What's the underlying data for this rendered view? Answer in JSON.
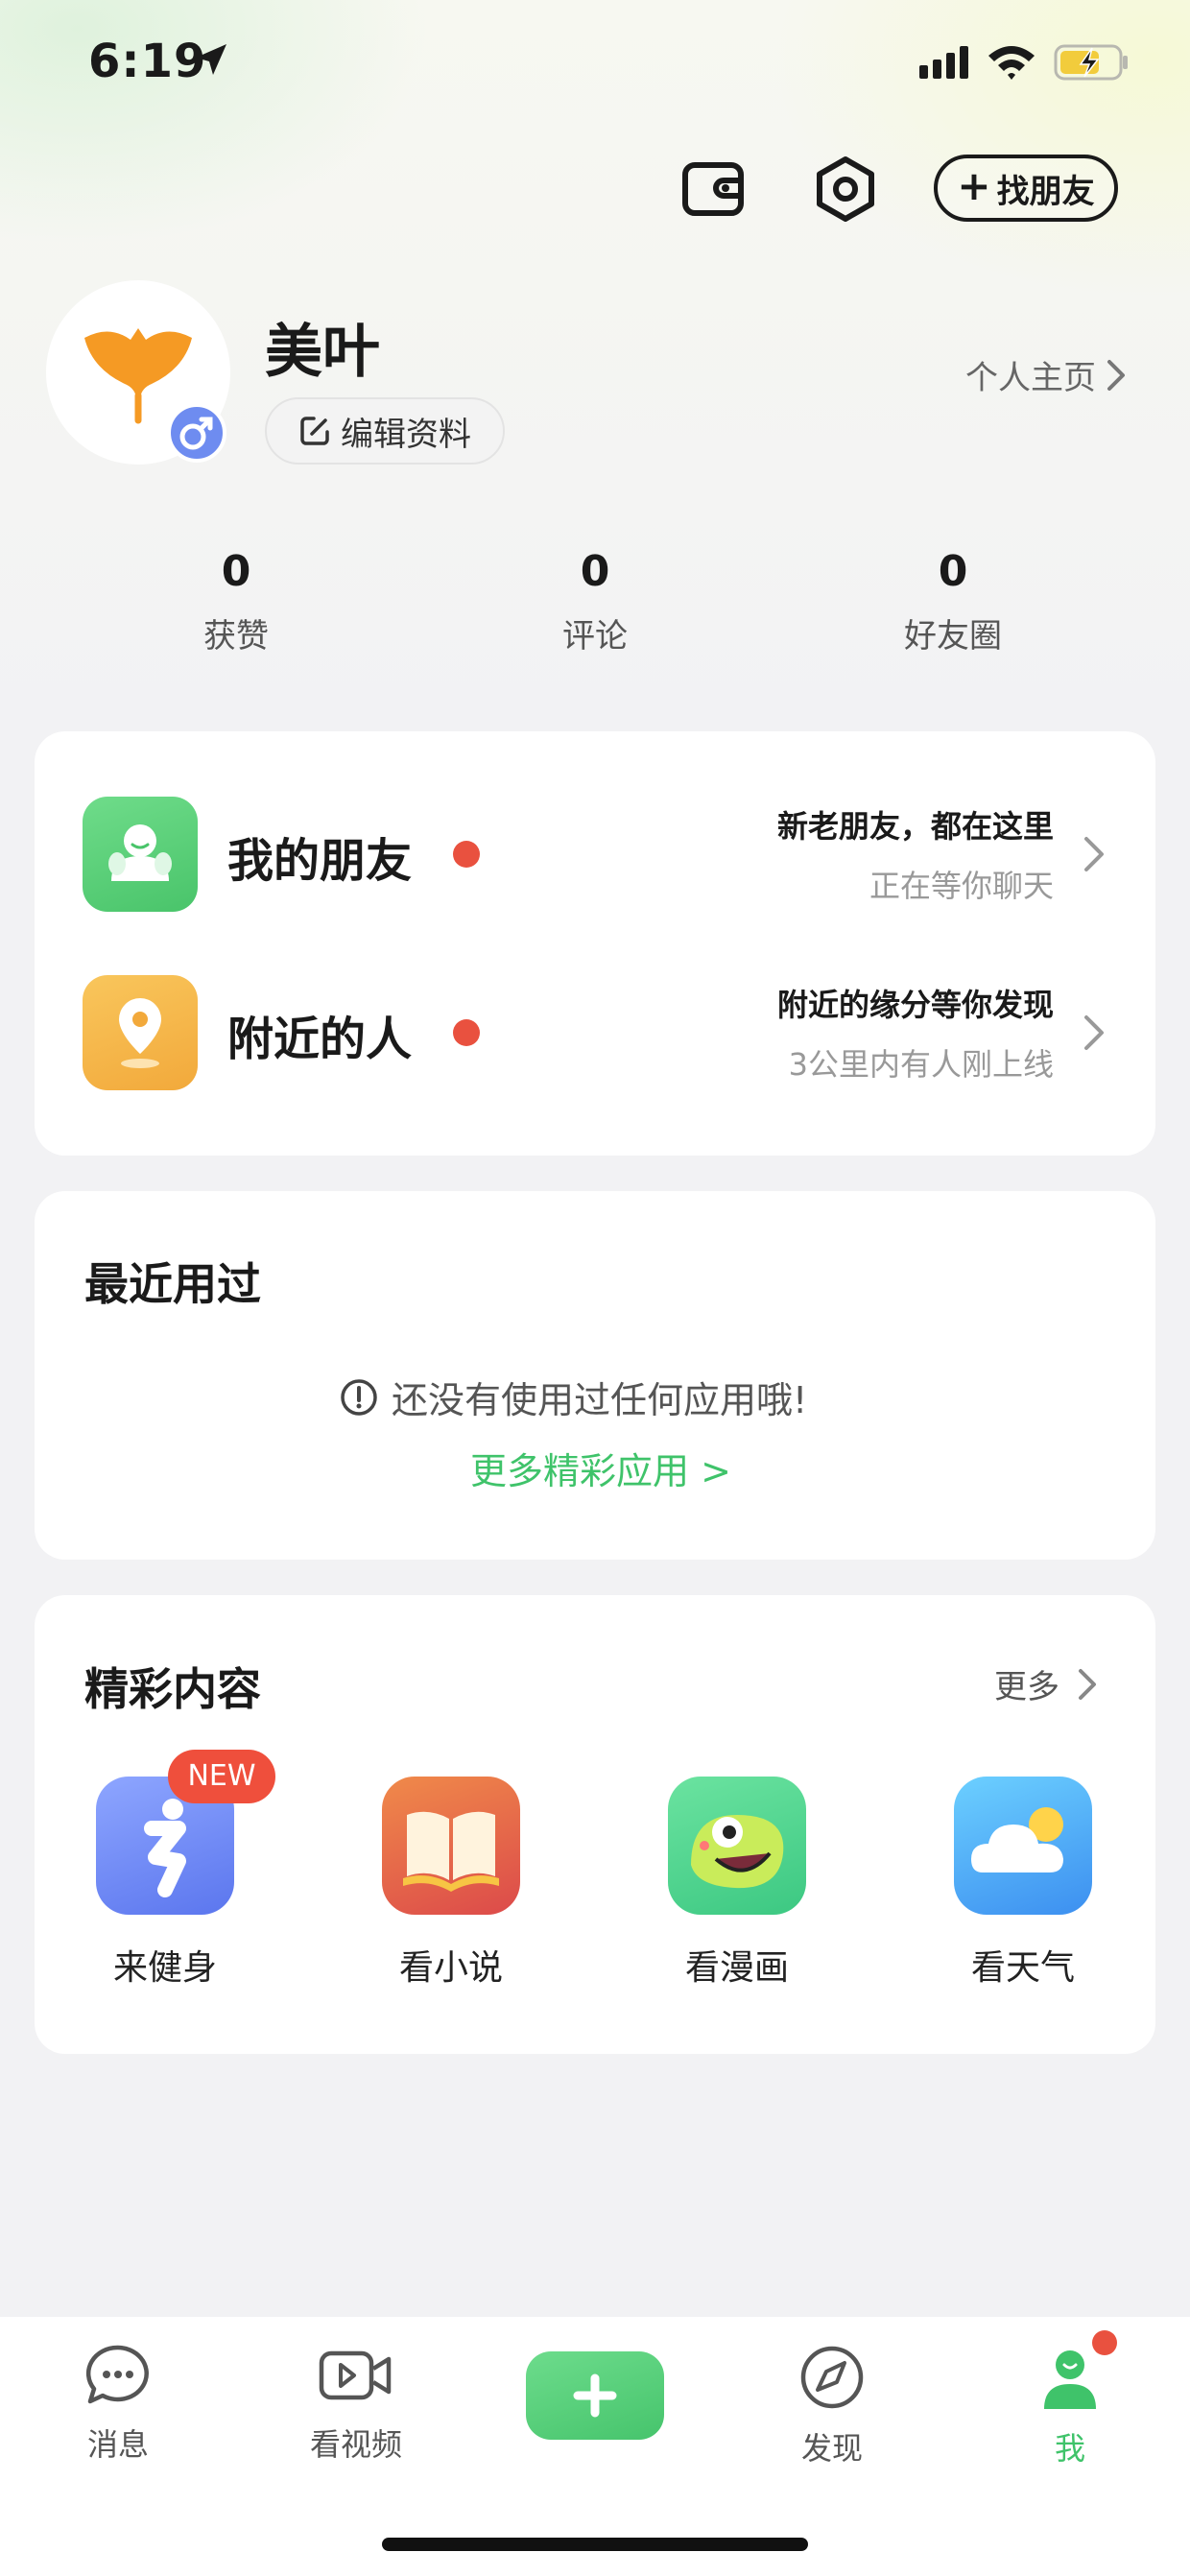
{
  "status_bar": {
    "time": "6:19"
  },
  "header": {
    "find_friends_label": "找朋友"
  },
  "profile": {
    "username": "美叶",
    "edit_label": "编辑资料",
    "homepage_label": "个人主页"
  },
  "stats": [
    {
      "value": "0",
      "label": "获赞"
    },
    {
      "value": "0",
      "label": "评论"
    },
    {
      "value": "0",
      "label": "好友圈"
    }
  ],
  "social_rows": [
    {
      "title": "我的朋友",
      "main": "新老朋友，都在这里",
      "sub": "正在等你聊天"
    },
    {
      "title": "附近的人",
      "main": "附近的缘分等你发现",
      "sub": "3公里内有人刚上线"
    }
  ],
  "recent": {
    "title": "最近用过",
    "empty_text": "还没有使用过任何应用哦!",
    "more_label": "更多精彩应用 >"
  },
  "featured": {
    "title": "精彩内容",
    "more_label": "更多",
    "new_badge": "NEW",
    "apps": [
      {
        "label": "来健身",
        "icon": "fitness-icon"
      },
      {
        "label": "看小说",
        "icon": "book-icon"
      },
      {
        "label": "看漫画",
        "icon": "comic-icon"
      },
      {
        "label": "看天气",
        "icon": "weather-icon"
      }
    ]
  },
  "tabs": [
    {
      "label": "消息",
      "icon": "chat-icon"
    },
    {
      "label": "看视频",
      "icon": "video-icon"
    },
    {
      "label": "",
      "icon": "plus-icon"
    },
    {
      "label": "发现",
      "icon": "compass-icon"
    },
    {
      "label": "我",
      "icon": "profile-icon",
      "active": true
    }
  ],
  "colors": {
    "accent_green": "#3fc36a",
    "red_dot": "#e9513f",
    "badge_blue": "#6e8cf0"
  }
}
